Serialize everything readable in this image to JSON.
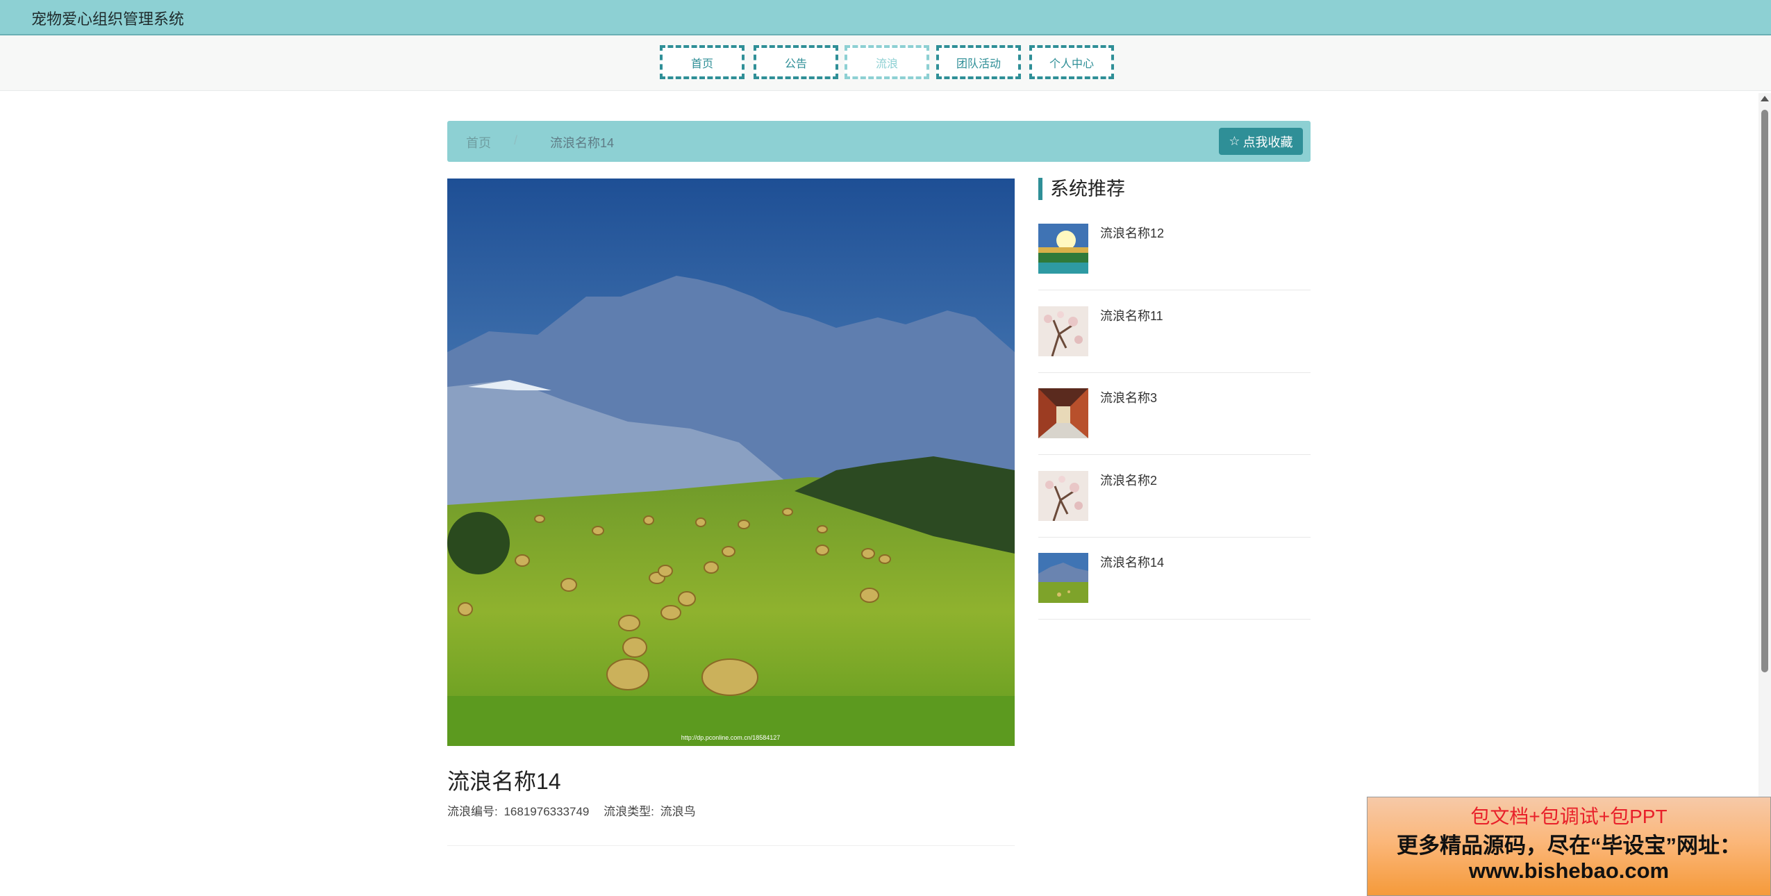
{
  "app": {
    "title": "宠物爱心组织管理系统"
  },
  "nav": {
    "items": [
      {
        "label": "首页"
      },
      {
        "label": "公告"
      },
      {
        "label": "流浪"
      },
      {
        "label": "团队活动"
      },
      {
        "label": "个人中心"
      }
    ],
    "active": "流浪"
  },
  "breadcrumb": {
    "home": "首页",
    "separator": "/",
    "current": "流浪名称14"
  },
  "favorite_button": {
    "icon": "star-outline-icon",
    "label": "点我收藏"
  },
  "detail": {
    "image_watermark": "http://dp.pconline.com.cn/18584127",
    "title": "流浪名称14",
    "fields": [
      {
        "label": "流浪编号:",
        "value": "1681976333749"
      },
      {
        "label": "流浪类型:",
        "value": "流浪鸟"
      }
    ]
  },
  "recommend": {
    "title": "系统推荐",
    "items": [
      {
        "name": "流浪名称12"
      },
      {
        "name": "流浪名称11"
      },
      {
        "name": "流浪名称3"
      },
      {
        "name": "流浪名称2"
      },
      {
        "name": "流浪名称14"
      }
    ]
  },
  "ad": {
    "line1": "包文档+包调试+包PPT",
    "line2": "更多精品源码，尽在“毕设宝”网址：",
    "line3": "www.bishebao.com"
  },
  "colors": {
    "header": "#8dd0d3",
    "accent": "#2f8f97"
  }
}
